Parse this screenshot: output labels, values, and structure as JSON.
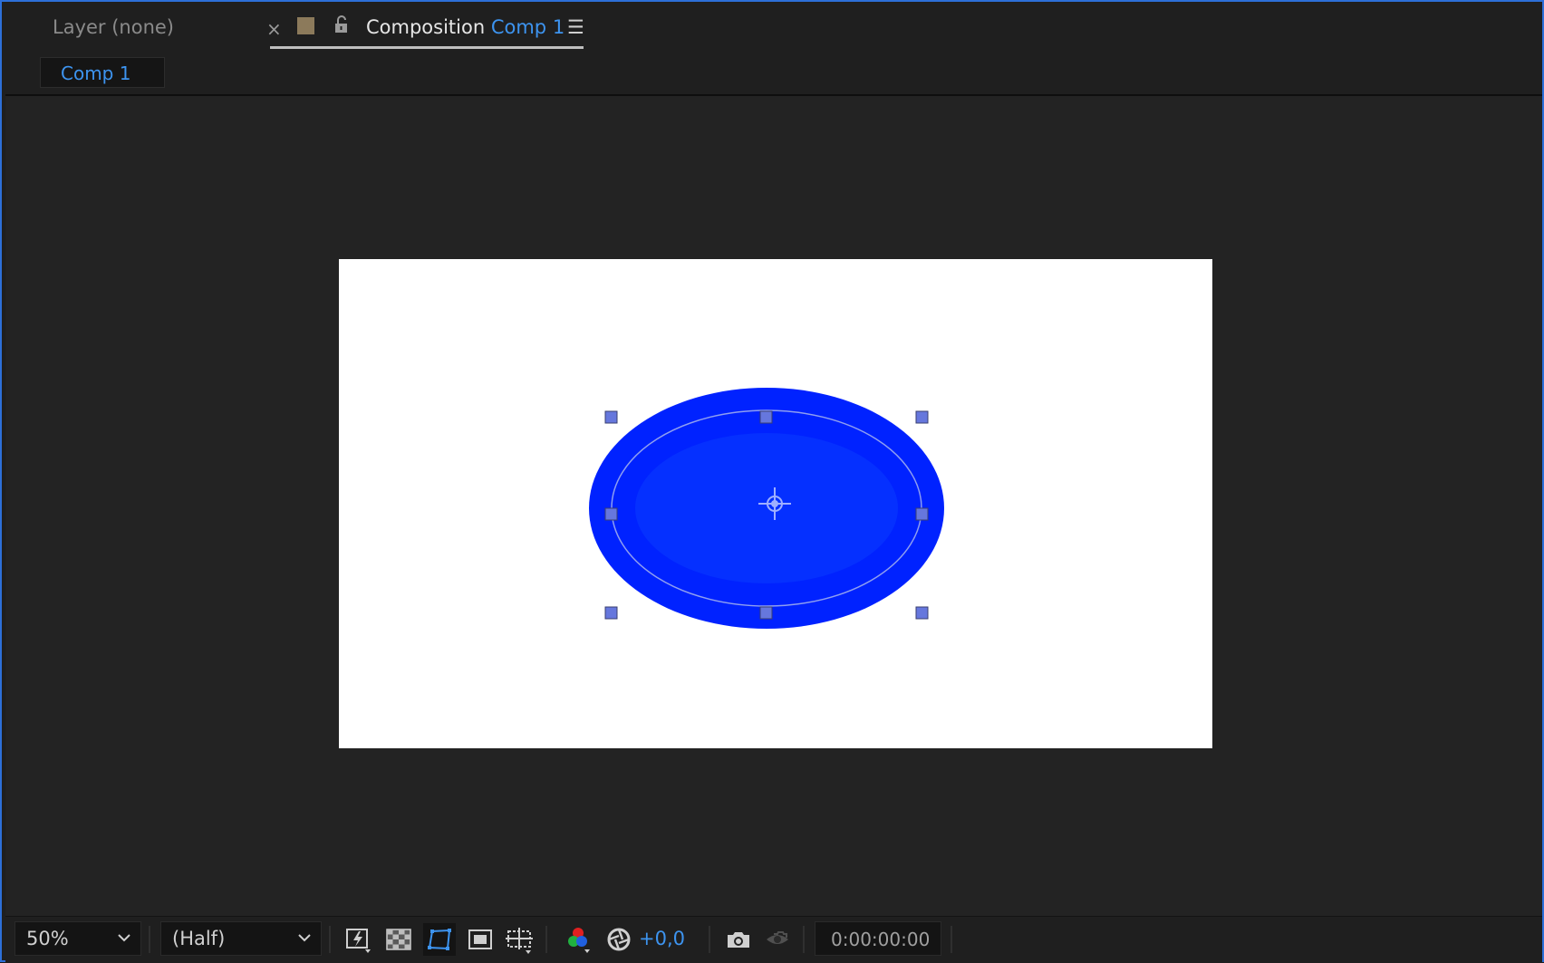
{
  "tabs": {
    "layer_tab": "Layer (none)",
    "composition_prefix": "Composition",
    "composition_name": "Comp 1",
    "close_glyph": "×",
    "menu_glyph": "☰"
  },
  "breadcrumb": {
    "label": "Comp 1"
  },
  "toolbar": {
    "magnification": "50%",
    "resolution": "(Half)",
    "exposure": "+0,0",
    "current_time": "0:00:00:00"
  },
  "colors": {
    "accent": "#3d94f0",
    "panel_border": "#2d6fd8",
    "shape_fill": "#0022ff",
    "handle": "#6677dd",
    "label_swatch": "#8c7a5b"
  },
  "icons": [
    "close-icon",
    "label-color-swatch",
    "unlock-icon",
    "panel-menu-icon",
    "chevron-down-icon",
    "fast-previews-icon",
    "transparency-grid-icon",
    "mask-visibility-icon",
    "region-of-interest-icon",
    "guides-icon",
    "channels-icon",
    "exposure-reset-icon",
    "snapshot-camera-icon",
    "show-snapshot-icon",
    "anchor-point-icon"
  ]
}
